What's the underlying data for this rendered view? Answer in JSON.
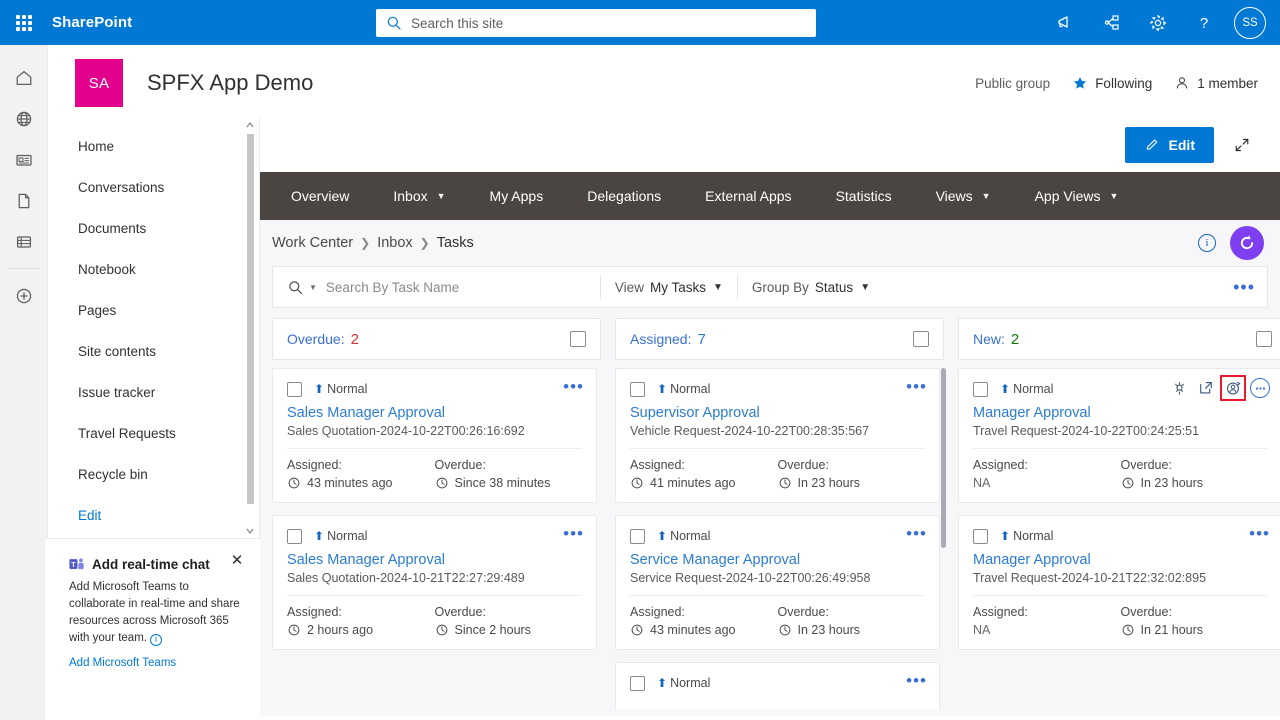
{
  "suite": {
    "brand": "SharePoint",
    "search_placeholder": "Search this site",
    "icons": [
      "megaphone-icon",
      "share-icon",
      "gear-icon",
      "help-icon"
    ],
    "avatar_initials": "SS"
  },
  "rail": {
    "items": [
      "home-icon",
      "globe-icon",
      "news-icon",
      "document-icon",
      "list-icon",
      "create-icon"
    ]
  },
  "site": {
    "logo_initials": "SA",
    "title": "SPFX App Demo",
    "privacy": "Public group",
    "following": "Following",
    "members": "1 member"
  },
  "leftnav": {
    "items": [
      {
        "label": "Home"
      },
      {
        "label": "Conversations"
      },
      {
        "label": "Documents"
      },
      {
        "label": "Notebook"
      },
      {
        "label": "Pages"
      },
      {
        "label": "Site contents"
      },
      {
        "label": "Issue tracker"
      },
      {
        "label": "Travel Requests"
      },
      {
        "label": "Recycle bin"
      },
      {
        "label": "Edit"
      }
    ]
  },
  "promo": {
    "title": "Add real-time chat",
    "body": "Add Microsoft Teams to collaborate in real-time and share resources across Microsoft 365 with your team.",
    "link": "Add Microsoft Teams"
  },
  "commandbar": {
    "edit_label": "Edit"
  },
  "webpart": {
    "tabs": [
      {
        "label": "Overview",
        "caret": false
      },
      {
        "label": "Inbox",
        "caret": true
      },
      {
        "label": "My Apps",
        "caret": false
      },
      {
        "label": "Delegations",
        "caret": false
      },
      {
        "label": "External Apps",
        "caret": false
      },
      {
        "label": "Statistics",
        "caret": false
      },
      {
        "label": "Views",
        "caret": true
      },
      {
        "label": "App Views",
        "caret": true
      }
    ],
    "breadcrumb": [
      "Work Center",
      "Inbox",
      "Tasks"
    ],
    "toolbar": {
      "search_placeholder": "Search By Task Name",
      "view_label": "View",
      "view_value": "My Tasks",
      "groupby_label": "Group By",
      "groupby_value": "Status",
      "more_label": "•••"
    },
    "columns": [
      {
        "name": "Overdue",
        "count": "2",
        "count_color": "#d13438",
        "cards": [
          {
            "priority": "Normal",
            "title": "Sales Manager Approval",
            "subtitle": "Sales Quotation-2024-10-22T00:26:16:692",
            "assigned_label": "Assigned:",
            "assigned_value": "43 minutes ago",
            "overdue_label": "Overdue:",
            "overdue_value": "Since 38 minutes",
            "hovered": false
          },
          {
            "priority": "Normal",
            "title": "Sales Manager Approval",
            "subtitle": "Sales Quotation-2024-10-21T22:27:29:489",
            "assigned_label": "Assigned:",
            "assigned_value": "2 hours ago",
            "overdue_label": "Overdue:",
            "overdue_value": "Since 2 hours",
            "hovered": false
          }
        ]
      },
      {
        "name": "Assigned",
        "count": "7",
        "count_color": "#2b7cd3",
        "cards": [
          {
            "priority": "Normal",
            "title": "Supervisor Approval",
            "subtitle": "Vehicle Request-2024-10-22T00:28:35:567",
            "assigned_label": "Assigned:",
            "assigned_value": "41 minutes ago",
            "overdue_label": "Overdue:",
            "overdue_value": "In 23 hours",
            "hovered": false
          },
          {
            "priority": "Normal",
            "title": "Service Manager Approval",
            "subtitle": "Service Request-2024-10-22T00:26:49:958",
            "assigned_label": "Assigned:",
            "assigned_value": "43 minutes ago",
            "overdue_label": "Overdue:",
            "overdue_value": "In 23 hours",
            "hovered": false
          },
          {
            "priority": "Normal",
            "title": "",
            "subtitle": "",
            "assigned_label": "",
            "assigned_value": "",
            "overdue_label": "",
            "overdue_value": "",
            "hovered": false,
            "partial": true
          }
        ]
      },
      {
        "name": "New",
        "count": "2",
        "count_color": "#107c10",
        "cards": [
          {
            "priority": "Normal",
            "title": "Manager Approval",
            "subtitle": "Travel Request-2024-10-22T00:24:25:51",
            "assigned_label": "Assigned:",
            "assigned_value": "NA",
            "assigned_is_na": true,
            "overdue_label": "Overdue:",
            "overdue_value": "In 23 hours",
            "hovered": true,
            "actions": [
              "workflow-icon",
              "open-new-window-icon",
              "reassign-icon",
              "more-icon"
            ],
            "highlighted_action_index": 2
          },
          {
            "priority": "Normal",
            "title": "Manager Approval",
            "subtitle": "Travel Request-2024-10-21T22:32:02:895",
            "assigned_label": "Assigned:",
            "assigned_value": "NA",
            "assigned_is_na": true,
            "overdue_label": "Overdue:",
            "overdue_value": "In 21 hours",
            "hovered": false
          }
        ]
      }
    ]
  },
  "colors": {
    "suite_blue": "#0078d4",
    "site_logo": "#e3008c",
    "tabbar": "#4a4541",
    "link": "#2b7cd3",
    "refresh": "#7d3ff0",
    "highlight": "#e8192c"
  }
}
